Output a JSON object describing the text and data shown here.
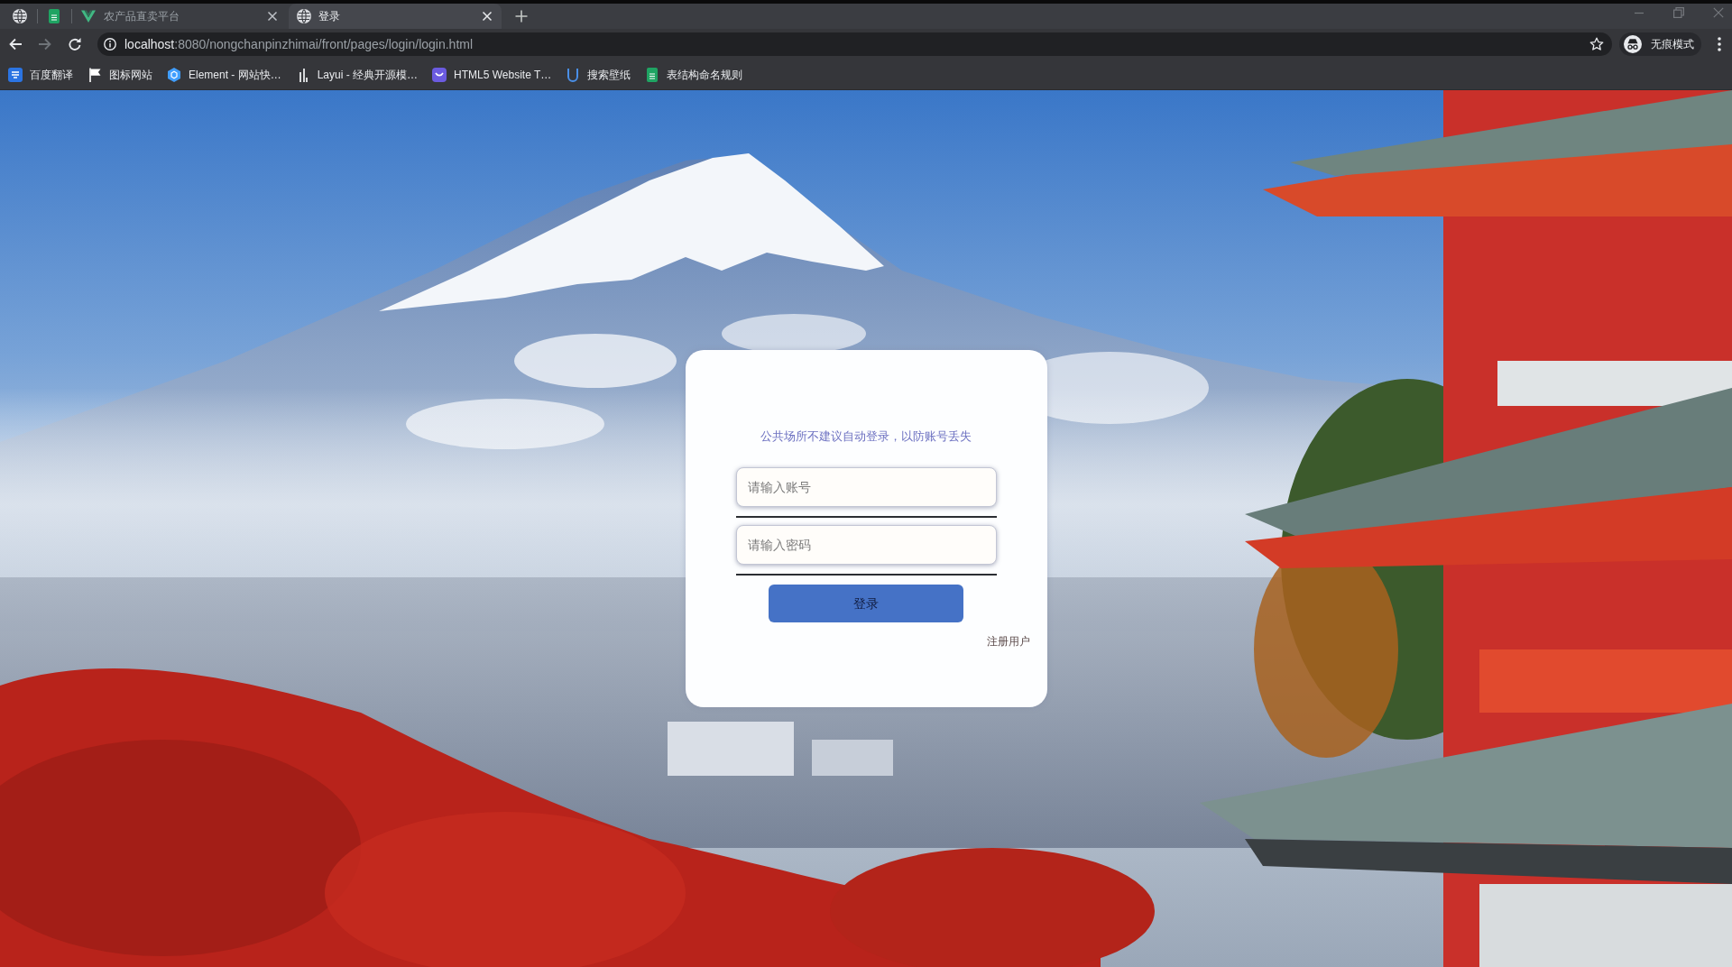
{
  "browser": {
    "tabs": [
      {
        "kind": "pinned",
        "selected": false
      },
      {
        "kind": "pinned",
        "selected": false
      },
      {
        "kind": "page",
        "title": "农产品直卖平台",
        "selected": false
      },
      {
        "kind": "page",
        "title": "登录",
        "selected": true
      }
    ],
    "nav_buttons": [
      {
        "kind": "back",
        "disabled": false
      },
      {
        "kind": "forward",
        "disabled": true
      },
      {
        "kind": "reload",
        "disabled": false
      }
    ],
    "address": {
      "host": "localhost",
      "path": ":8080/nongchanpinzhimai/front/pages/login/login.html"
    },
    "profile": {
      "label": "无痕模式"
    },
    "bookmarks": [
      {
        "label": "百度翻译"
      },
      {
        "label": "图标网站"
      },
      {
        "label": "Element - 网站快…"
      },
      {
        "label": "Layui - 经典开源模…"
      },
      {
        "label": "HTML5 Website T…"
      },
      {
        "label": "搜索壁纸"
      },
      {
        "label": "表结构命名规则"
      }
    ]
  },
  "login": {
    "notice": "公共场所不建议自动登录，以防账号丢失",
    "fields": [
      {
        "placeholder": "请输入账号"
      },
      {
        "placeholder": "请输入密码"
      }
    ],
    "submit": "登录",
    "register_link": "注册用户"
  }
}
